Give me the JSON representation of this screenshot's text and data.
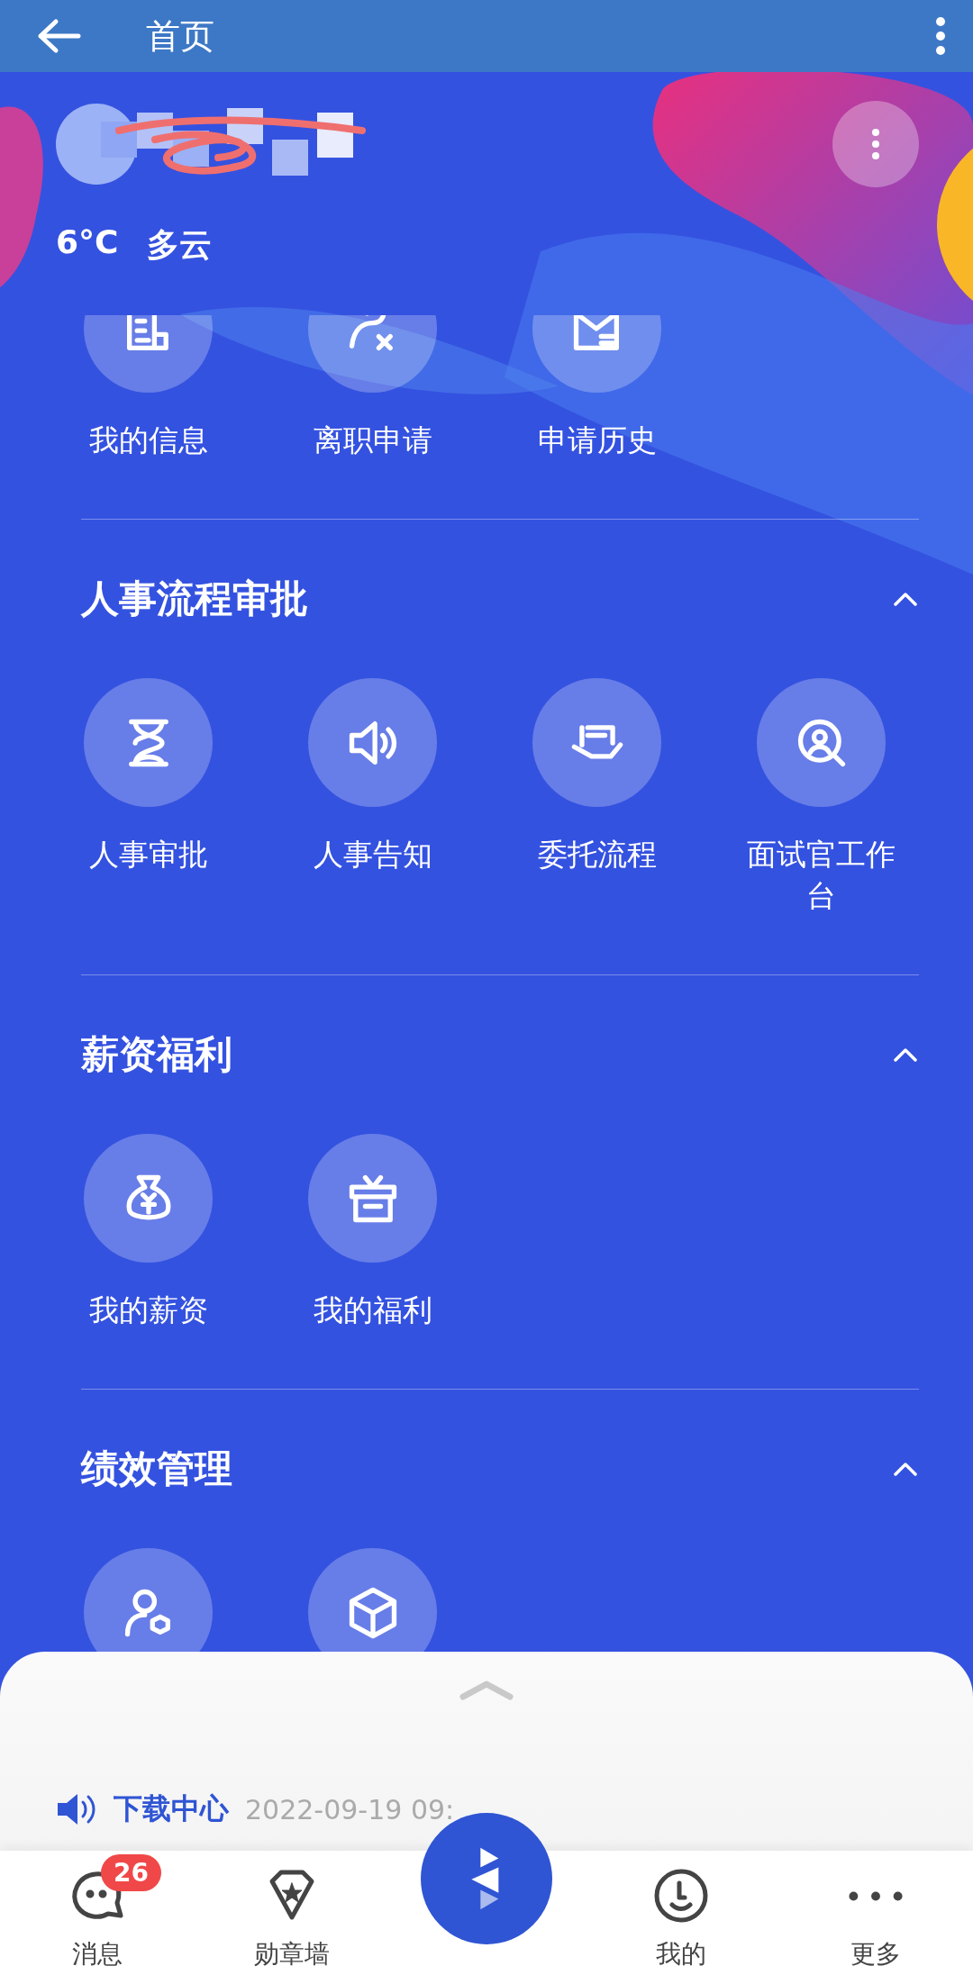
{
  "app_bar": {
    "title": "首页"
  },
  "weather": {
    "temperature": "6°C",
    "condition": "多云"
  },
  "sections": [
    {
      "items": [
        {
          "label": "我的信息"
        },
        {
          "label": "离职申请"
        },
        {
          "label": "申请历史"
        }
      ]
    },
    {
      "title": "人事流程审批",
      "expanded": true,
      "items": [
        {
          "label": "人事审批"
        },
        {
          "label": "人事告知"
        },
        {
          "label": "委托流程"
        },
        {
          "label": "面试官工作台"
        }
      ]
    },
    {
      "title": "薪资福利",
      "expanded": true,
      "items": [
        {
          "label": "我的薪资"
        },
        {
          "label": "我的福利"
        }
      ]
    },
    {
      "title": "绩效管理",
      "expanded": true
    }
  ],
  "notice": {
    "source": "下载中心",
    "time": "2022-09-19 09:"
  },
  "tabs": [
    {
      "label": "消息",
      "badge": "26",
      "selected": false
    },
    {
      "label": "勋章墙",
      "selected": false
    },
    {
      "label": "我的",
      "selected": false
    },
    {
      "label": "更多",
      "selected": false
    }
  ]
}
